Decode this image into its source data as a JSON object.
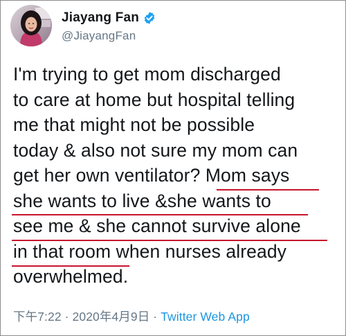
{
  "user": {
    "display_name": "Jiayang Fan",
    "handle": "@JiayangFan",
    "verified": true
  },
  "tweet": {
    "lines": [
      "I'm trying to get mom discharged",
      "to care at home but hospital telling",
      "me that might not be possible",
      "today & also not sure my mom can",
      "get her own ventilator? Mom says",
      "she wants to live &she wants to",
      "see me & she cannot survive alone",
      "in that room when nurses already",
      "overwhelmed."
    ]
  },
  "meta": {
    "time": "下午7:22",
    "separator1": " · ",
    "date": "2020年4月9日",
    "separator2": " · ",
    "source": "Twitter Web App"
  },
  "colors": {
    "accent": "#1b95e0",
    "verified_badge": "#1da1f2",
    "underline": "#c8142d",
    "secondary_text": "#657786",
    "border": "#8c8c8c"
  }
}
